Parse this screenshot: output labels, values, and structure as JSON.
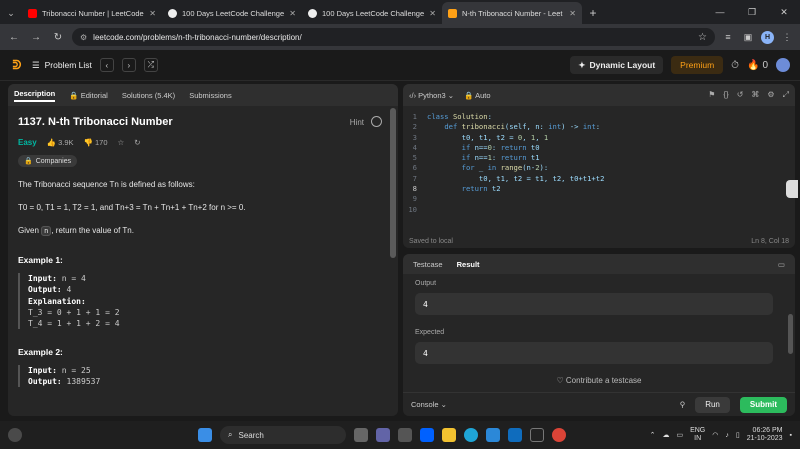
{
  "browser": {
    "tabs": [
      {
        "label": "Tribonacci Number | LeetCode",
        "favicon_color": "#ff0000",
        "active": false
      },
      {
        "label": "100 Days LeetCode Challenge",
        "favicon_color": "#eeeeee",
        "active": false
      },
      {
        "label": "100 Days LeetCode Challenge",
        "favicon_color": "#eeeeee",
        "active": false
      },
      {
        "label": "N-th Tribonacci Number - Leet",
        "favicon_color": "#ffa116",
        "active": true
      }
    ],
    "url": "leetcode.com/problems/n-th-tribonacci-number/description/",
    "profile_initial": "H"
  },
  "header": {
    "problem_list": "Problem List",
    "dynamic_layout": "Dynamic Layout",
    "premium": "Premium",
    "streak": "0"
  },
  "left": {
    "tabs": [
      "Description",
      "Editorial",
      "Solutions (5.4K)",
      "Submissions"
    ],
    "title": "1137. N-th Tribonacci Number",
    "hint": "Hint",
    "difficulty": "Easy",
    "likes": "3.9K",
    "dislikes": "170",
    "companies": "Companies",
    "para1": "The Tribonacci sequence Tn is defined as follows:",
    "para2": "T0 = 0, T1 = 1, T2 = 1, and Tn+3 = Tn + Tn+1 + Tn+2 for n >= 0.",
    "para3_pre": "Given",
    "para3_code": "n",
    "para3_post": ", return the value of Tn.",
    "ex1_title": "Example 1:",
    "ex1_input_label": "Input:",
    "ex1_input": "n = 4",
    "ex1_output_label": "Output:",
    "ex1_output": "4",
    "ex1_expl_label": "Explanation:",
    "ex1_l1": "T_3 = 0 + 1 + 1 = 2",
    "ex1_l2": "T_4 = 1 + 1 + 2 = 4",
    "ex2_title": "Example 2:",
    "ex2_input_label": "Input:",
    "ex2_input": "n = 25",
    "ex2_output_label": "Output:",
    "ex2_output": "1389537"
  },
  "editor": {
    "language": "Python3",
    "mode": "Auto",
    "saved": "Saved to local",
    "cursor": "Ln 8, Col 18",
    "line_numbers": [
      "1",
      "2",
      "3",
      "4",
      "5",
      "6",
      "7",
      "8",
      "9",
      "10"
    ]
  },
  "result": {
    "tabs": [
      "Testcase",
      "Result"
    ],
    "output_label": "Output",
    "output_value": "4",
    "expected_label": "Expected",
    "expected_value": "4",
    "contribute": "Contribute a testcase",
    "console": "Console",
    "run": "Run",
    "submit": "Submit"
  },
  "taskbar": {
    "search": "Search",
    "lang": "ENG",
    "region": "IN",
    "time": "06:26 PM",
    "date": "21-10-2023"
  }
}
